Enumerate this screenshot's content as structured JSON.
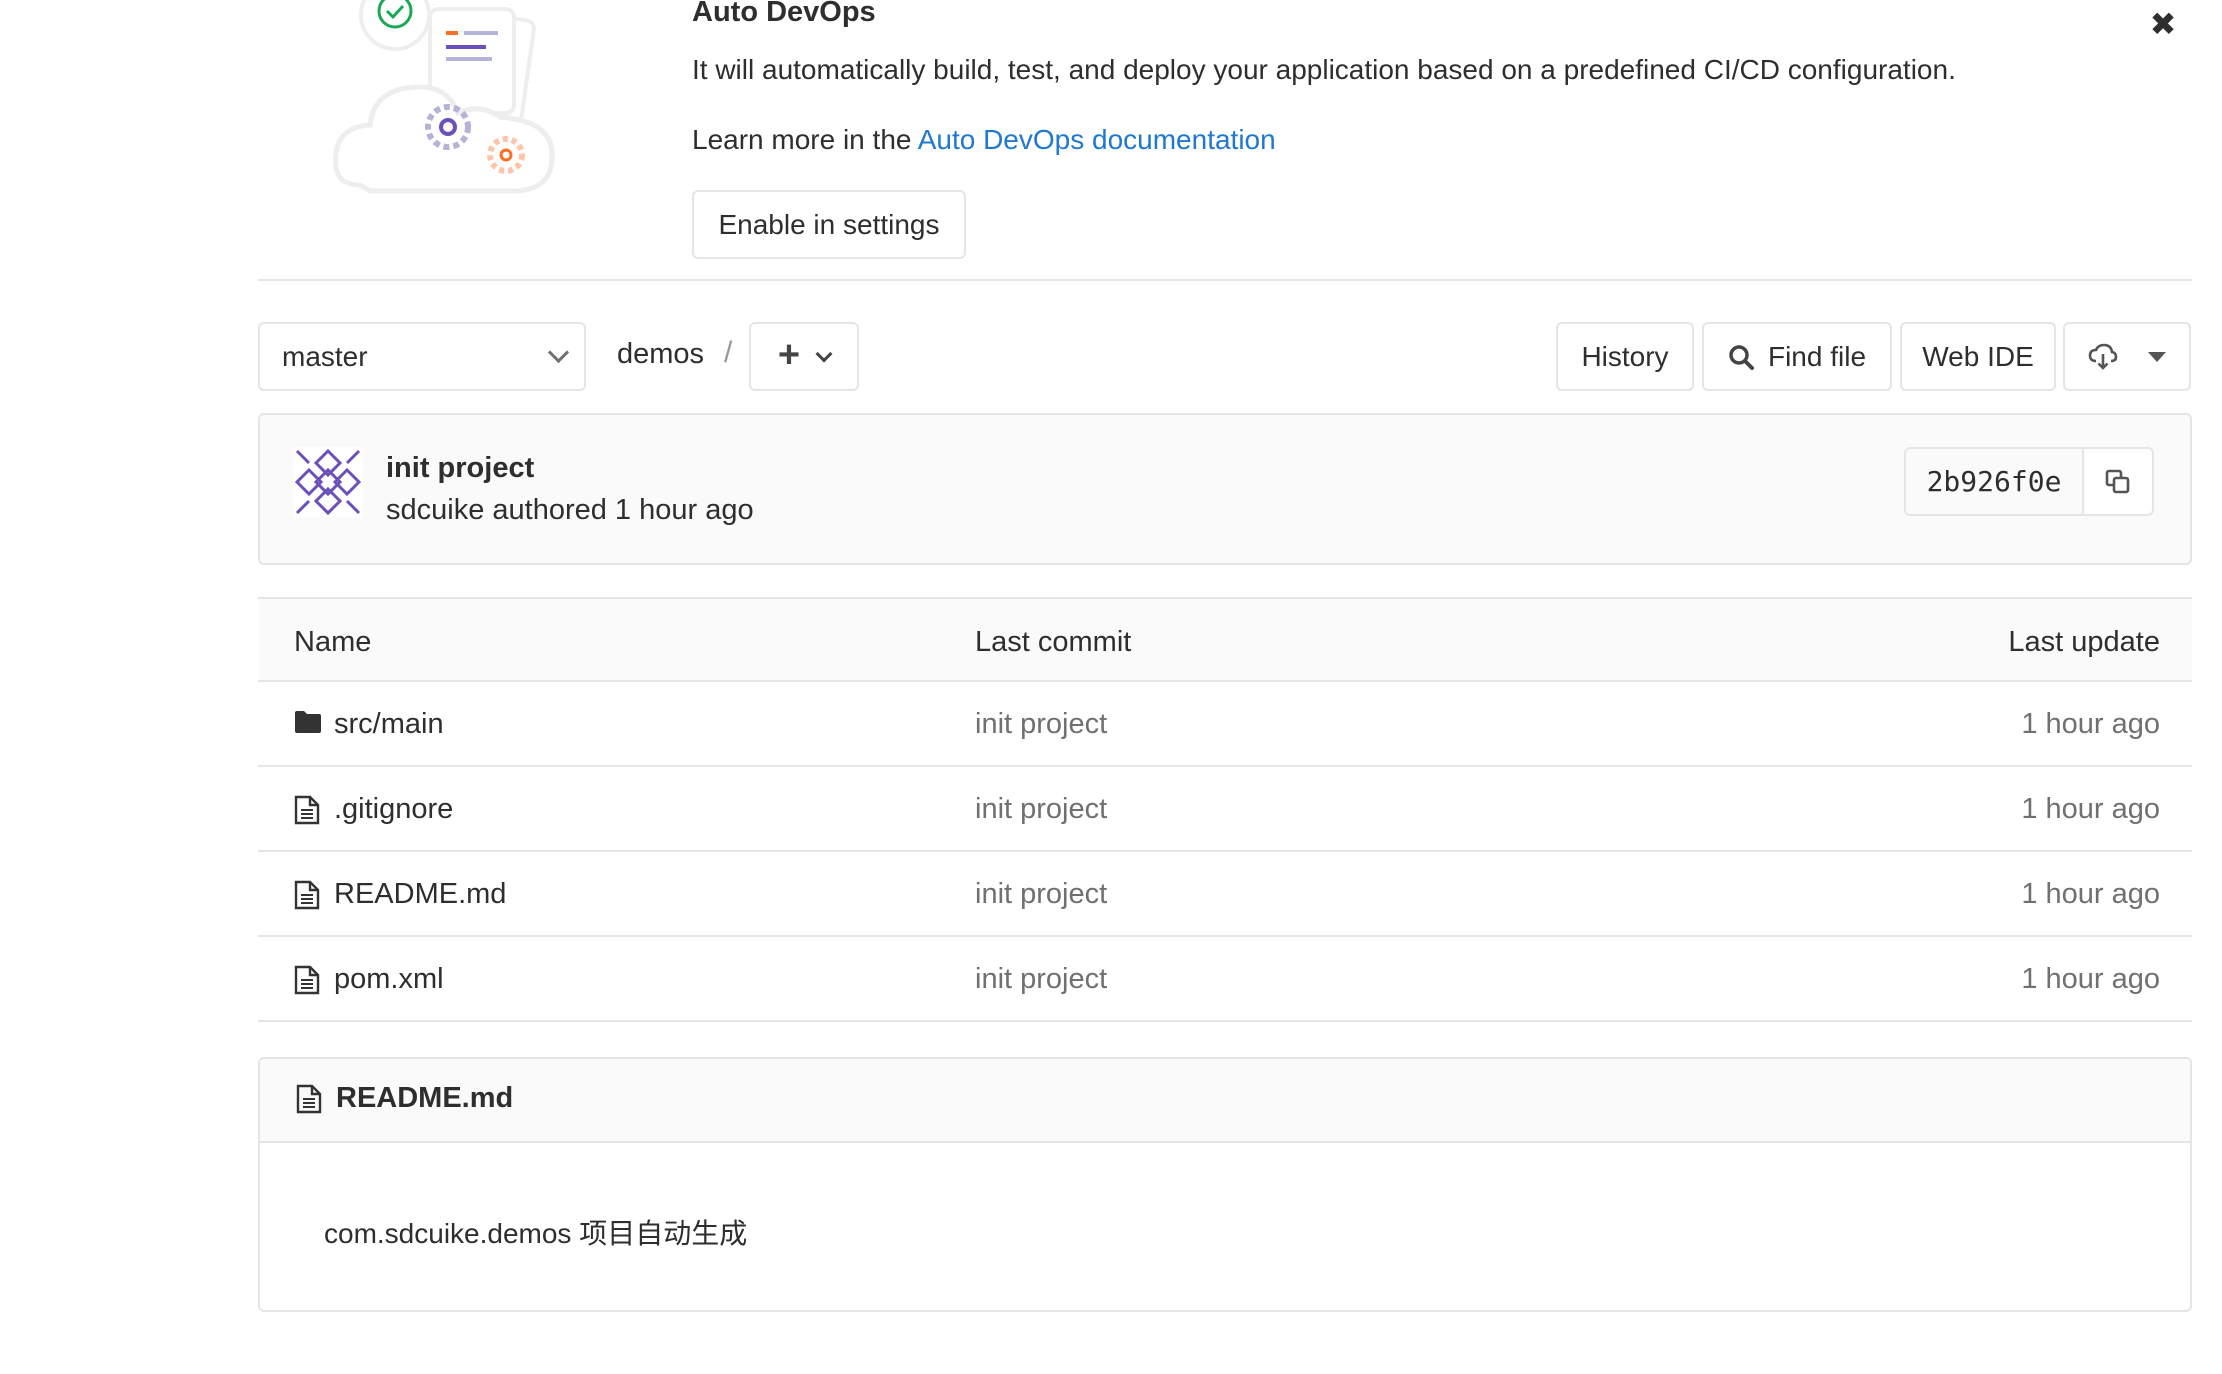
{
  "banner": {
    "title": "Auto DevOps",
    "description": "It will automatically build, test, and deploy your application based on a predefined CI/CD configuration.",
    "learn_prefix": "Learn more in the ",
    "learn_link": "Auto DevOps documentation",
    "enable_button": "Enable in settings",
    "close_icon": "close-icon"
  },
  "toolbar": {
    "branch": "master",
    "breadcrumb": "demos",
    "separator": "/",
    "add_icon": "plus-icon",
    "history": "History",
    "find_file": "Find file",
    "web_ide": "Web IDE",
    "download_icon": "cloud-download-icon"
  },
  "commit": {
    "title": "init project",
    "meta": "sdcuike authored 1 hour ago",
    "sha": "2b926f0e",
    "copy_icon": "copy-icon"
  },
  "table": {
    "columns": [
      "Name",
      "Last commit",
      "Last update"
    ],
    "rows": [
      {
        "icon": "folder-icon",
        "name": "src/main",
        "commit": "init project",
        "updated": "1 hour ago"
      },
      {
        "icon": "file-icon",
        "name": ".gitignore",
        "commit": "init project",
        "updated": "1 hour ago"
      },
      {
        "icon": "file-icon",
        "name": "README.md",
        "commit": "init project",
        "updated": "1 hour ago"
      },
      {
        "icon": "file-icon",
        "name": "pom.xml",
        "commit": "init project",
        "updated": "1 hour ago"
      }
    ]
  },
  "readme": {
    "title": "README.md",
    "content": "com.sdcuike.demos 项目自动生成"
  },
  "colors": {
    "link": "#1f78d1",
    "border": "#e5e5e5",
    "header_bg": "#fafafa",
    "muted_text": "#707070"
  }
}
